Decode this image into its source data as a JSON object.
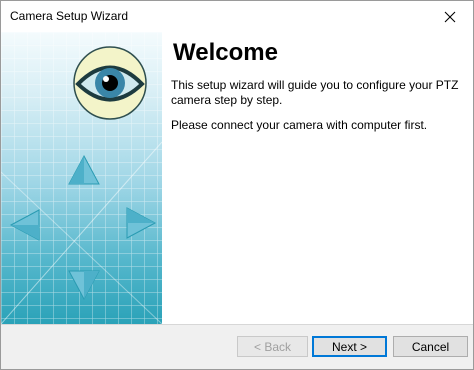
{
  "window": {
    "title": "Camera Setup Wizard"
  },
  "welcome": {
    "heading": "Welcome",
    "line1": "This setup wizard will guide you to configure your PTZ",
    "line2": "camera step by step.",
    "line3": "Please connect your camera with computer first."
  },
  "buttons": {
    "back": "< Back",
    "next": "Next >",
    "cancel": "Cancel"
  },
  "icons": {
    "close": "close-icon",
    "eye": "eye-icon",
    "arrow_up": "arrow-up-icon",
    "arrow_down": "arrow-down-icon",
    "arrow_left": "arrow-left-icon",
    "arrow_right": "arrow-right-icon"
  },
  "colors": {
    "accent": "#0078d7",
    "banner_top": "#f4fbfd",
    "banner_bottom": "#2aa2b8"
  }
}
